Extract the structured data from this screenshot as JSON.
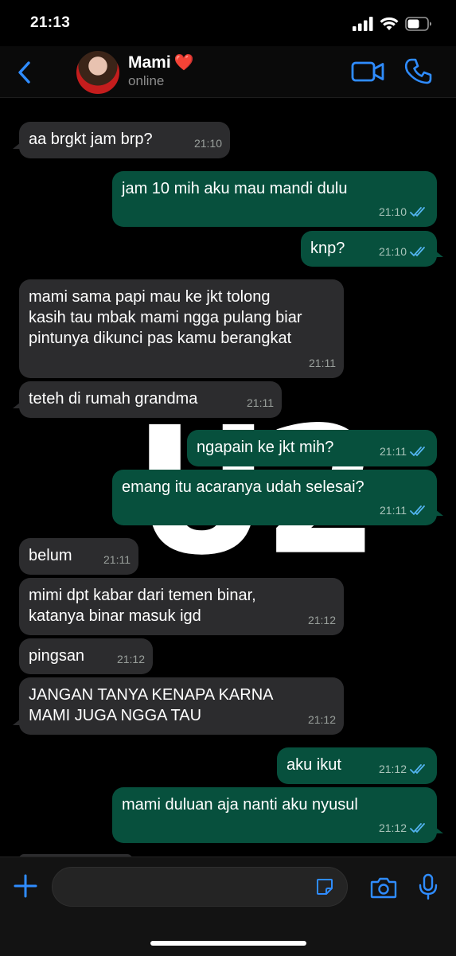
{
  "status_bar": {
    "time": "21:13"
  },
  "header": {
    "contact_name": "Mami",
    "heart": "❤️",
    "status": "online"
  },
  "colors": {
    "accent": "#2f8cff",
    "incoming": "#2c2c2e",
    "outgoing": "#07503d",
    "read_ticks": "#53b4f0"
  },
  "wallpaper": {
    "text": "U2"
  },
  "messages": [
    {
      "dir": "in",
      "text": "aa brgkt jam brp?",
      "time": "21:10"
    },
    {
      "dir": "out",
      "text": "jam 10 mih aku mau mandi dulu",
      "time": "21:10",
      "read": true
    },
    {
      "dir": "out",
      "text": "knp?",
      "time": "21:10",
      "read": true
    },
    {
      "dir": "in",
      "text": "mami sama papi mau ke jkt tolong\nkasih tau mbak mami ngga pulang biar\npintunya dikunci pas kamu berangkat",
      "time": "21:11"
    },
    {
      "dir": "in",
      "text": "teteh di rumah grandma",
      "time": "21:11"
    },
    {
      "dir": "out",
      "text": "ngapain ke jkt mih?",
      "time": "21:11",
      "read": true
    },
    {
      "dir": "out",
      "text": "emang itu acaranya udah selesai?",
      "time": "21:11",
      "read": true
    },
    {
      "dir": "in",
      "text": "belum",
      "time": "21:11"
    },
    {
      "dir": "in",
      "text": "mimi dpt kabar dari temen binar,\nkatanya binar masuk igd",
      "time": "21:12"
    },
    {
      "dir": "in",
      "text": "pingsan",
      "time": "21:12"
    },
    {
      "dir": "in",
      "text": "JANGAN TANYA KENAPA KARNA\nMAMI JUGA NGGA TAU",
      "time": "21:12"
    },
    {
      "dir": "out",
      "text": "aku ikut",
      "time": "21:12",
      "read": true
    },
    {
      "dir": "out",
      "text": "mami duluan aja nanti aku nyusul",
      "time": "21:12",
      "read": true
    }
  ],
  "icons": {
    "back": "chevron-left-icon",
    "video": "video-camera-icon",
    "call": "phone-icon",
    "attach": "plus-icon",
    "sticker": "sticker-icon",
    "camera": "camera-icon",
    "mic": "microphone-icon"
  }
}
